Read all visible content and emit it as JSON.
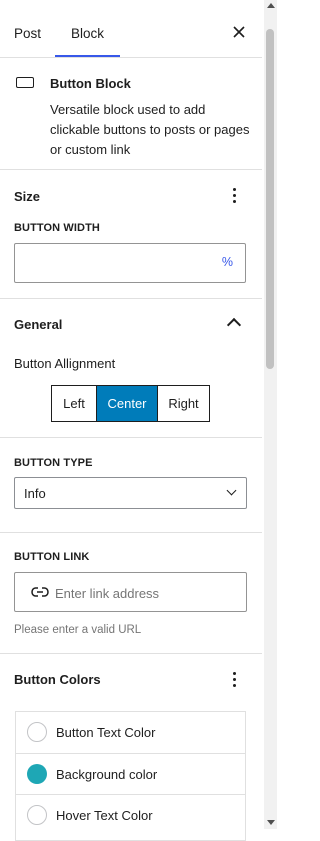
{
  "tabs": {
    "post_label": "Post",
    "block_label": "Block"
  },
  "block_card": {
    "title": "Button Block",
    "description": "Versatile block used to add clickable buttons to posts or pages or custom link"
  },
  "size_panel": {
    "title": "Size",
    "width_label": "BUTTON WIDTH",
    "width_value": "",
    "width_unit": "%"
  },
  "general_panel": {
    "title": "General",
    "alignment_label": "Button Allignment",
    "alignment_options": [
      "Left",
      "Center",
      "Right"
    ],
    "alignment_selected": "Center",
    "type_label": "BUTTON TYPE",
    "type_value": "Info",
    "link_label": "BUTTON LINK",
    "link_placeholder": "Enter link address",
    "link_help": "Please enter a valid URL"
  },
  "colors_panel": {
    "title": "Button Colors",
    "items": [
      {
        "label": "Button Text Color",
        "color": null
      },
      {
        "label": "Background color",
        "color": "#1ea7b5"
      },
      {
        "label": "Hover Text Color",
        "color": null
      }
    ]
  },
  "colors": {
    "accent": "#3858e9",
    "button_primary": "#007cba"
  }
}
